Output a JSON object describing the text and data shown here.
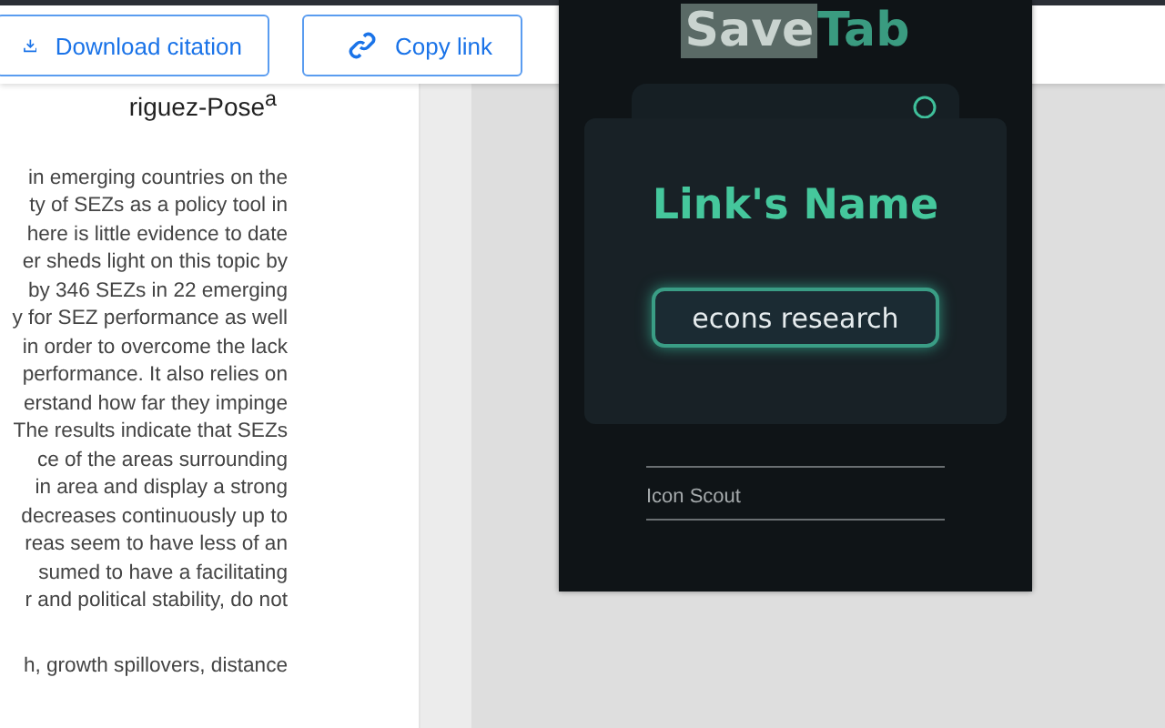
{
  "toolbar": {
    "buttons": [
      {
        "kind": "download",
        "label": "Download citation"
      },
      {
        "kind": "link",
        "label": "Copy link"
      }
    ]
  },
  "article": {
    "author": "riguez-Pose$^{a}$",
    "abstract_lines": [
      "in emerging countries on the",
      "ty of SEZs as a policy tool in",
      "here is little evidence to date",
      "er sheds light on this topic by",
      "by 346 SEZs in 22 emerging",
      "y for SEZ performance as well",
      "in order to overcome the lack",
      "performance. It also relies on",
      "erstand how far they impinge",
      "The results indicate that SEZs",
      "ce of the areas surrounding",
      "in area and display a strong",
      "decreases continuously up to",
      "reas seem to have less of an",
      "sumed to have a facilitating",
      "r and political stability, do not"
    ],
    "keywords_line": "h, growth spillovers, distance"
  },
  "popup": {
    "title_parts": [
      "Save",
      "Tab"
    ],
    "links": [
      "Icon Scout"
    ],
    "dialog": {
      "title": "Link's Name",
      "value": "econs research"
    }
  }
}
